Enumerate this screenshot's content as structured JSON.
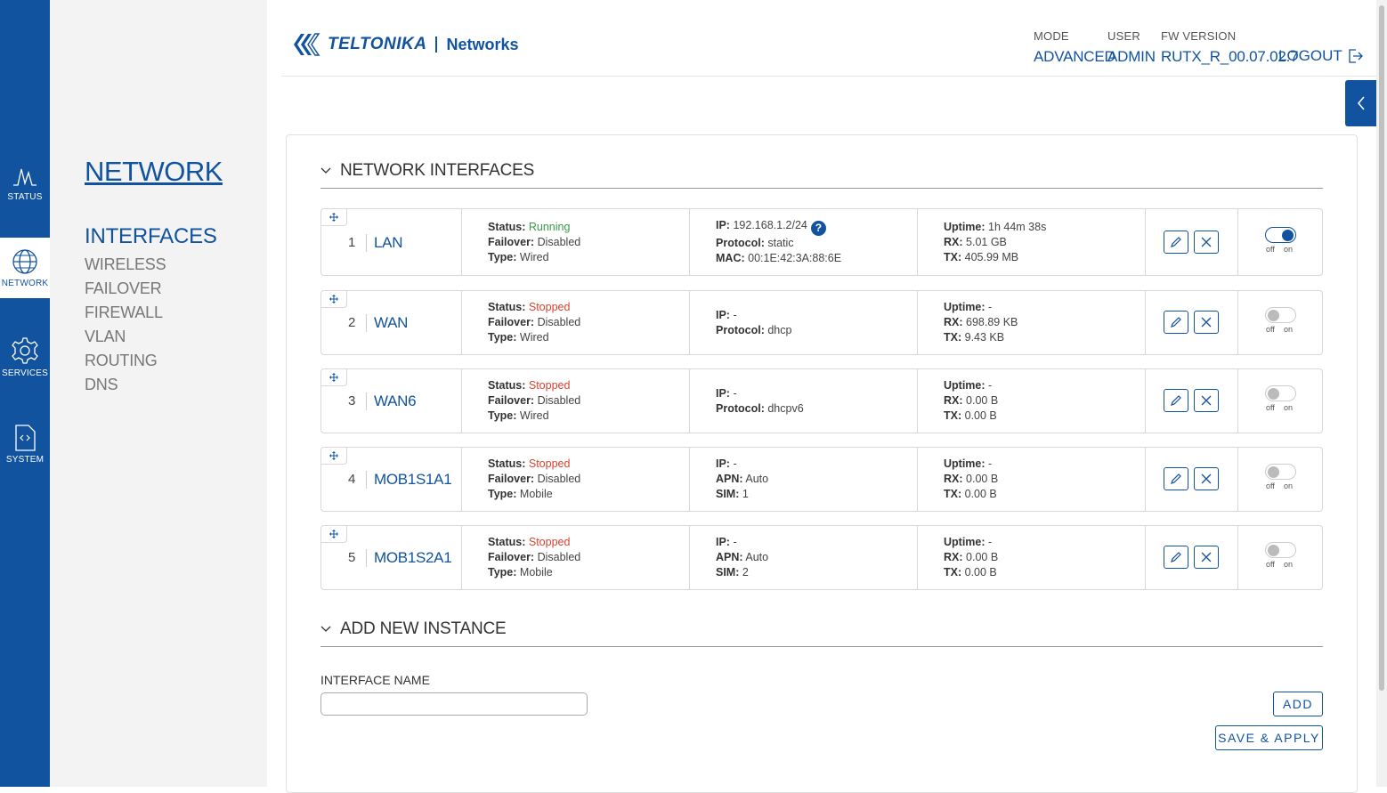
{
  "leftbar": [
    {
      "label": "STATUS",
      "icon": "status-icon"
    },
    {
      "label": "NETWORK",
      "icon": "globe-icon"
    },
    {
      "label": "SERVICES",
      "icon": "gear-icon"
    },
    {
      "label": "SYSTEM",
      "icon": "code-file-icon"
    }
  ],
  "subnav": {
    "title": "NETWORK",
    "items": [
      "INTERFACES",
      "WIRELESS",
      "FAILOVER",
      "FIREWALL",
      "VLAN",
      "ROUTING",
      "DNS"
    ]
  },
  "header": {
    "brand": "TELTONIKA",
    "product": "Networks",
    "mode_label": "MODE",
    "mode_value": "ADVANCED",
    "user_label": "USER",
    "user_value": "ADMIN",
    "fw_label": "FW VERSION",
    "fw_value": "RUTX_R_00.07.02.7",
    "logout": "LOGOUT"
  },
  "section1": "NETWORK INTERFACES",
  "labels": {
    "status": "Status:",
    "failover": "Failover:",
    "type": "Type:",
    "ip": "IP:",
    "protocol": "Protocol:",
    "mac": "MAC:",
    "apn": "APN:",
    "sim": "SIM:",
    "uptime": "Uptime:",
    "rx": "RX:",
    "tx": "TX:",
    "off": "off",
    "on": "on",
    "help": "?"
  },
  "interfaces": [
    {
      "num": "1",
      "name": "LAN",
      "status": "Running",
      "failover": "Disabled",
      "type": "Wired",
      "ip": "192.168.1.2/24",
      "protocol": "static",
      "mac": "00:1E:42:3A:88:6E",
      "uptime": "1h 44m 38s",
      "rx": "5.01 GB",
      "tx": "405.99 MB",
      "enabled": true
    },
    {
      "num": "2",
      "name": "WAN",
      "status": "Stopped",
      "failover": "Disabled",
      "type": "Wired",
      "ip": "-",
      "protocol": "dhcp",
      "uptime": "-",
      "rx": "698.89 KB",
      "tx": "9.43 KB",
      "enabled": false
    },
    {
      "num": "3",
      "name": "WAN6",
      "status": "Stopped",
      "failover": "Disabled",
      "type": "Wired",
      "ip": "-",
      "protocol": "dhcpv6",
      "uptime": "-",
      "rx": "0.00 B",
      "tx": "0.00 B",
      "enabled": false
    },
    {
      "num": "4",
      "name": "MOB1S1A1",
      "status": "Stopped",
      "failover": "Disabled",
      "type": "Mobile",
      "ip": "-",
      "apn": "Auto",
      "sim": "1",
      "uptime": "-",
      "rx": "0.00 B",
      "tx": "0.00 B",
      "enabled": false
    },
    {
      "num": "5",
      "name": "MOB1S2A1",
      "status": "Stopped",
      "failover": "Disabled",
      "type": "Mobile",
      "ip": "-",
      "apn": "Auto",
      "sim": "2",
      "uptime": "-",
      "rx": "0.00 B",
      "tx": "0.00 B",
      "enabled": false
    }
  ],
  "section2": "ADD NEW INSTANCE",
  "form": {
    "label": "INTERFACE NAME",
    "value": "",
    "add": "ADD",
    "save": "SAVE & APPLY"
  },
  "colors": {
    "primary": "#1253a0",
    "running": "#3a9a46",
    "stopped": "#d9432f"
  }
}
